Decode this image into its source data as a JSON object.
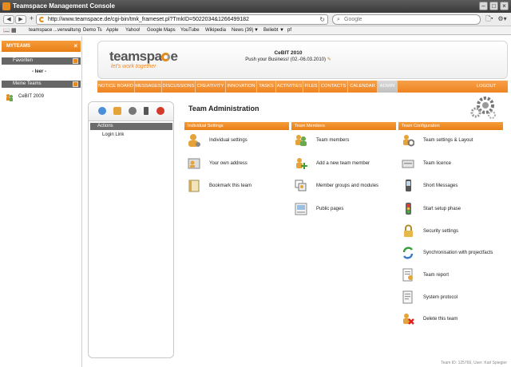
{
  "window": {
    "title": "Teamspace Management Console"
  },
  "browser": {
    "url": "http://www.teamspace.de/cgi-bin/tmk_frameset.pl?TmkID=5022034&1266499182",
    "search_placeholder": "Google",
    "bookmarks": [
      "teamspace ...verwaltung",
      "Demo Ts",
      "Apple",
      "Yahoo!",
      "Google Maps",
      "YouTube",
      "Wikipedia",
      "News (39)",
      "Beliebt",
      "pf"
    ]
  },
  "sidebar": {
    "header": "MYTEAMS",
    "favorites_label": "Favoriten",
    "favorites_empty": "- leer -",
    "myteams_label": "Meine Teams",
    "team_name": "CeBIT 2009"
  },
  "banner": {
    "logo_text": "teamspa",
    "logo_last": "e",
    "tagline": "let's work together",
    "event_name": "CeBIT 2010",
    "event_tagline": "Push your Business! (02.-06.03.2010)"
  },
  "menu": [
    "NOTICE BOARD",
    "MESSAGES",
    "DISCUSSIONS",
    "CREATIVITY",
    "INNOVATION",
    "TASKS",
    "ACTIVITIES",
    "FILES",
    "CONTACTS",
    "CALENDAR",
    "ADMIN",
    "LOGOUT"
  ],
  "actions": {
    "header": "Actions",
    "login_link": "Login Link"
  },
  "admin": {
    "title": "Team Administration",
    "columns": [
      {
        "header": "Individual Settings",
        "items": [
          "Individual settings",
          "Your own address",
          "Bookmark this team"
        ]
      },
      {
        "header": "Team Members",
        "items": [
          "Team members",
          "Add a new team member",
          "Member groups and modules",
          "Public pages"
        ]
      },
      {
        "header": "Team Configuration",
        "items": [
          "Team settings & Layout",
          "Team licence",
          "Short Messages",
          "Start setup phase",
          "Security settings",
          "Synchronisation with projectfacts",
          "Team report",
          "System protocol",
          "Delete this team"
        ]
      }
    ]
  },
  "footer": "Team ID: 125766, User: Karl Spiegler"
}
